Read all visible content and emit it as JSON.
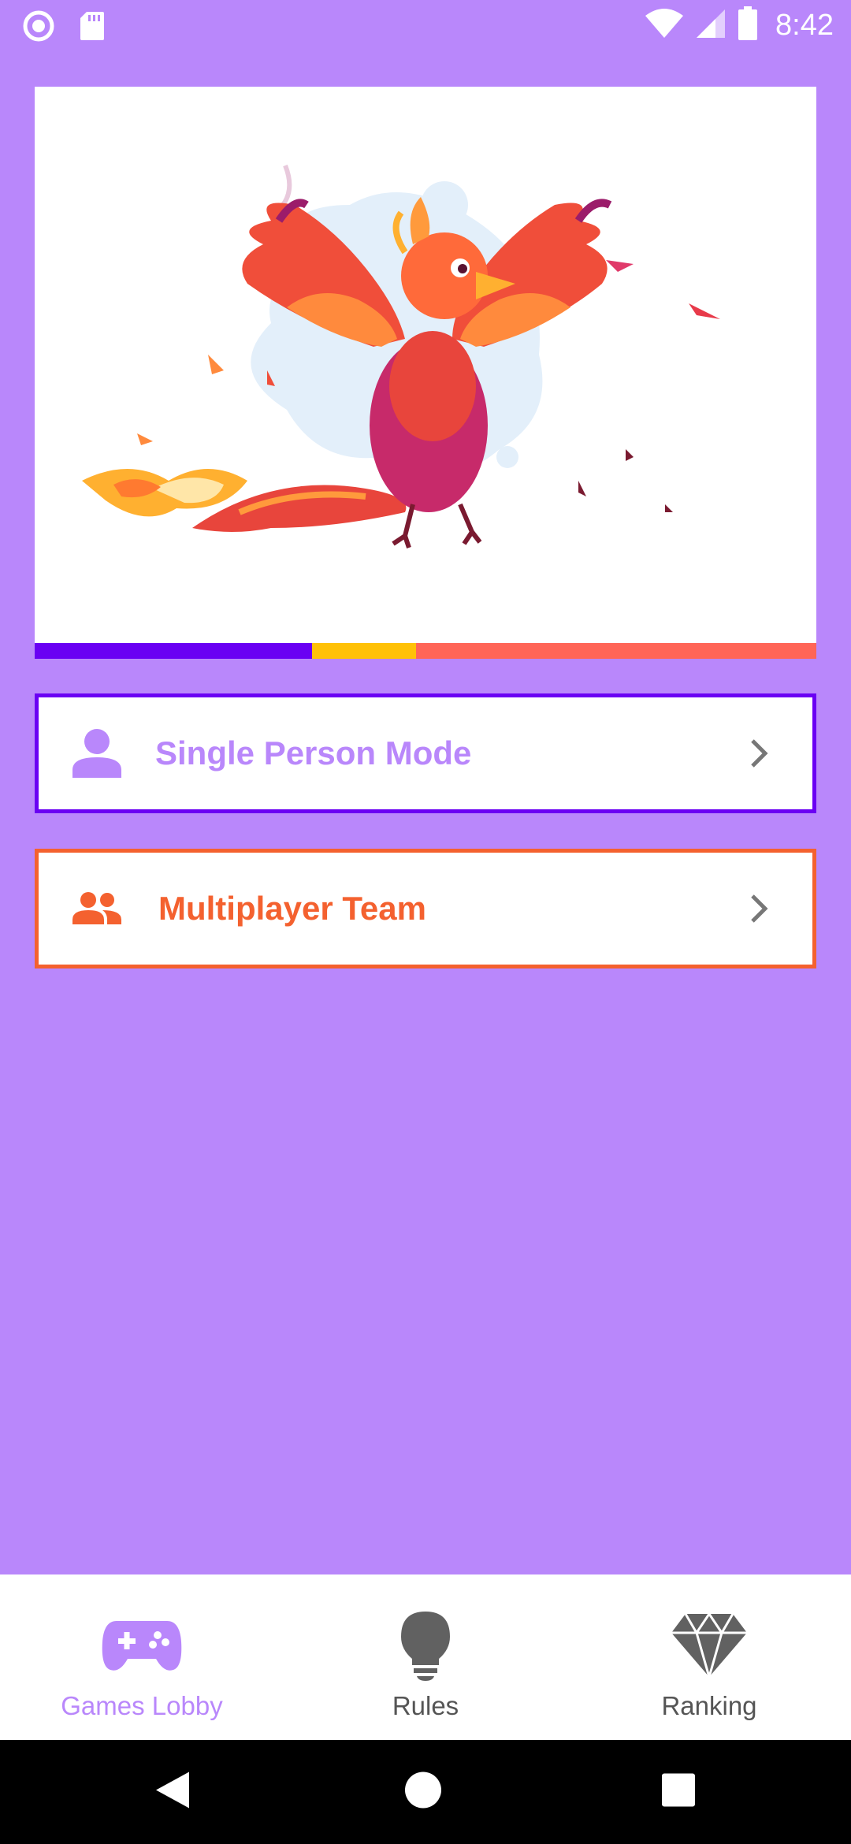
{
  "status_bar": {
    "time": "8:42",
    "left_icons": [
      "record-icon",
      "sd-card-icon"
    ],
    "right_icons": [
      "wifi-icon",
      "cell-signal-icon",
      "battery-icon"
    ]
  },
  "hero": {
    "image": "phoenix-illustration",
    "progress_segments": [
      {
        "color": "#6a00f3"
      },
      {
        "color": "#ffc107"
      },
      {
        "color": "#ff6557"
      }
    ]
  },
  "modes": {
    "single": {
      "label": "Single Person Mode",
      "icon": "person-icon",
      "color": "#6a00f3"
    },
    "multi": {
      "label": "Multiplayer Team",
      "icon": "group-icon",
      "color": "#f4612f"
    }
  },
  "bottom_nav": {
    "items": [
      {
        "label": "Games Lobby",
        "icon": "gamepad-icon",
        "active": true
      },
      {
        "label": "Rules",
        "icon": "lightbulb-icon",
        "active": false
      },
      {
        "label": "Ranking",
        "icon": "diamond-icon",
        "active": false
      }
    ]
  },
  "system_nav": {
    "buttons": [
      "back-icon",
      "home-icon",
      "recents-icon"
    ]
  },
  "colors": {
    "background": "#b987fb",
    "accent_purple": "#6a00f3",
    "accent_orange": "#f4612f",
    "active_nav": "#b987fb"
  }
}
